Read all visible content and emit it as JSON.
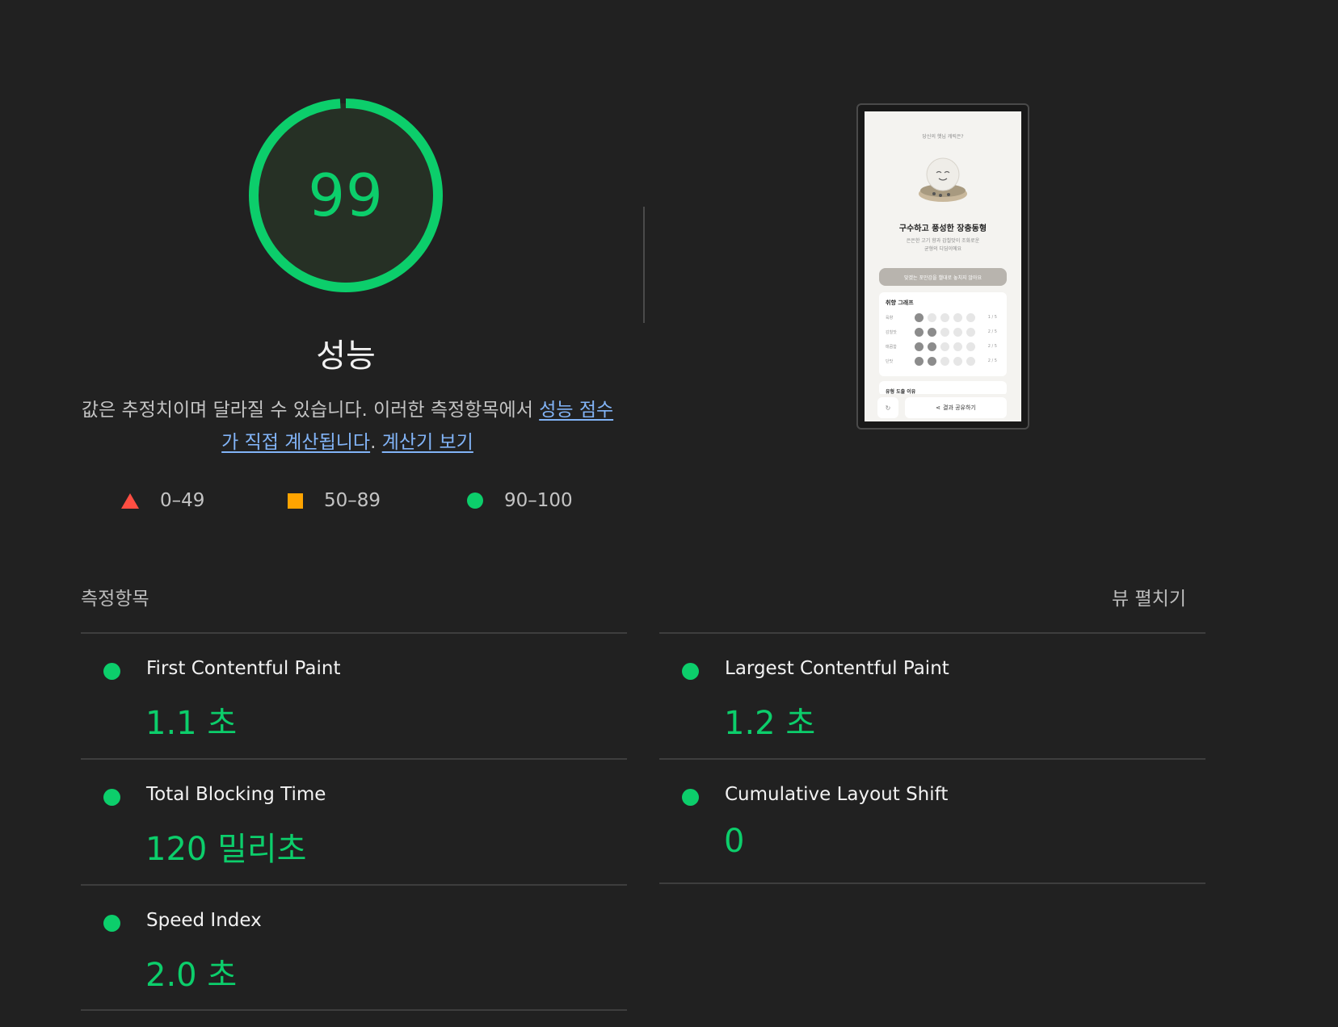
{
  "score": {
    "value": 99,
    "title": "성능",
    "color": "#0cce6b"
  },
  "description": {
    "text1": "값은 추정치이며 달라질 수 있습니다. 이러한 측정항목에서 ",
    "link1": "성능 점수가 직접 계산됩니다",
    "text2": ". ",
    "link2": "계산기 보기"
  },
  "legend": [
    {
      "icon": "triangle-icon",
      "label": "0–49",
      "color": "#ff4e42"
    },
    {
      "icon": "square-icon",
      "label": "50–89",
      "color": "#ffa400"
    },
    {
      "icon": "circle-icon",
      "label": "90–100",
      "color": "#0cce6b"
    }
  ],
  "screenshot": {
    "top_text": "당신의 햇님 캐릭은?",
    "title": "구수하고 풍성한 장충동형",
    "subtitle1": "은은한 고기 향과 감칠맛이 조화로운",
    "subtitle2": "균형의 디딤이에요",
    "banner": "맞겠는 포만감을 챌대로 놓치지 않아요",
    "card_title": "취향 그래프",
    "rows": [
      {
        "label": "육향",
        "filled": 1,
        "frac": "1 / 5"
      },
      {
        "label": "감칠맛",
        "filled": 2,
        "frac": "2 / 5"
      },
      {
        "label": "매콤함",
        "filled": 2,
        "frac": "2 / 5"
      },
      {
        "label": "단맛",
        "filled": 2,
        "frac": "2 / 5"
      }
    ],
    "card2_title": "유형 도출 이유",
    "refresh": "↻",
    "share": "결과 공유하기"
  },
  "metrics_label": "측정항목",
  "expand_label": "뷰 펼치기",
  "metrics": [
    {
      "name": "First Contentful Paint",
      "value": "1.1 초"
    },
    {
      "name": "Largest Contentful Paint",
      "value": "1.2 초"
    },
    {
      "name": "Total Blocking Time",
      "value": "120 밀리초"
    },
    {
      "name": "Cumulative Layout Shift",
      "value": "0"
    },
    {
      "name": "Speed Index",
      "value": "2.0 초"
    }
  ]
}
